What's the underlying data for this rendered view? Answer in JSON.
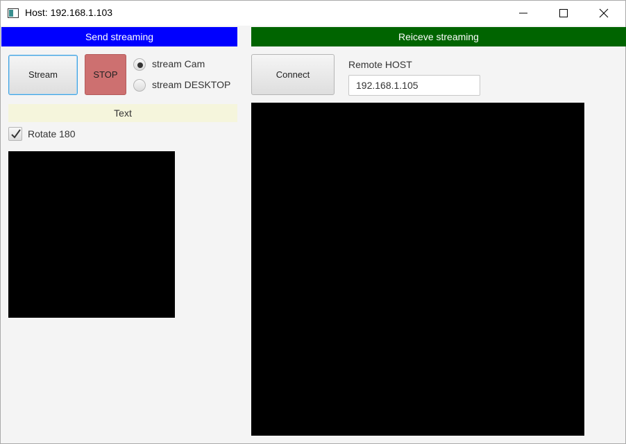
{
  "window": {
    "title": "Host: 192.168.1.103",
    "icon": "app-window-icon"
  },
  "controls": {
    "minimize": "minimize-icon",
    "maximize": "maximize-icon",
    "close": "close-icon"
  },
  "send": {
    "header": "Send streaming",
    "header_color": "#0000ff",
    "stream_button": "Stream",
    "stop_button": "STOP",
    "stop_color": "#cd7070",
    "source_options": [
      {
        "label": "stream Cam",
        "selected": true
      },
      {
        "label": "stream DESKTOP",
        "selected": false
      }
    ],
    "text_label": "Text",
    "rotate_checkbox": {
      "label": "Rotate 180",
      "checked": true
    }
  },
  "receive": {
    "header": "Reiceve streaming",
    "header_color": "#006400",
    "connect_button": "Connect",
    "remote_host_label": "Remote HOST",
    "remote_host_value": "192.168.1.105"
  }
}
